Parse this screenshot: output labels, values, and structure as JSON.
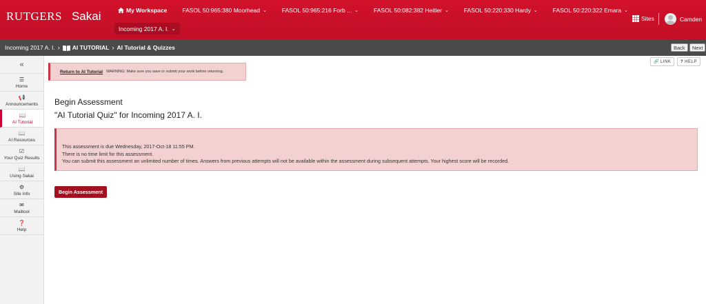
{
  "header": {
    "logo_primary": "RUTGERS",
    "logo_secondary": "Sakai",
    "workspace_label": "My Workspace",
    "site_tabs": [
      {
        "label": "FASOL 50:965:380 Moorhead"
      },
      {
        "label": "FASOL 50:965:216 Forb ..."
      },
      {
        "label": "FASOL 50:082:382 Heitler"
      },
      {
        "label": "FASOL 50:220:330 Hardy"
      },
      {
        "label": "FASOL 50:220:322 Emara"
      }
    ],
    "current_site": "Incoming 2017 A. I.",
    "sites_label": "Sites",
    "user_name": "Camden"
  },
  "breadcrumb": {
    "site": "Incoming 2017 A. I.",
    "tool": "AI TUTORIAL",
    "page": "AI Tutorial & Quizzes",
    "back_label": "Back",
    "next_label": "Next"
  },
  "toolmenu": {
    "collapse_icon": "«",
    "items": [
      {
        "label": "Home",
        "icon": "list-icon",
        "glyph": "☰"
      },
      {
        "label": "Announcements",
        "icon": "megaphone-icon",
        "glyph": "📢"
      },
      {
        "label": "AI Tutorial",
        "icon": "book-icon",
        "glyph": "📖"
      },
      {
        "label": "AI Resources",
        "icon": "book-icon",
        "glyph": "📖"
      },
      {
        "label": "Your Quiz Results",
        "icon": "checkbox-icon",
        "glyph": "☑"
      },
      {
        "label": "Using Sakai",
        "icon": "book-icon",
        "glyph": "📖"
      },
      {
        "label": "Site Info",
        "icon": "gear-icon",
        "glyph": "⚙"
      },
      {
        "label": "Mailtool",
        "icon": "envelope-icon",
        "glyph": "✉"
      },
      {
        "label": "Help",
        "icon": "help-icon",
        "glyph": "❓"
      }
    ]
  },
  "main": {
    "warning_link": "Return to AI Tutorial",
    "warning_text": "WARNING: Make sure you save or submit your work before returning.",
    "link_label": "LINK",
    "help_label": "HELP",
    "title": "Begin Assessment",
    "subtitle": "\"AI Tutorial Quiz\" for Incoming 2017 A. I.",
    "info_lines": [
      "This assessment is due Wednesday, 2017-Oct-18 11:55 PM.",
      "There is no time limit for this assessment.",
      "You can submit this assessment an unlimited number of times. Answers from previous attempts will not be available within the assessment during subsequent attempts. Your highest score will be recorded."
    ],
    "begin_button": "Begin Assessment"
  },
  "colors": {
    "brand_red": "#cc0033",
    "breadcrumb_bg": "#4a4a4a",
    "alert_bg": "#f3d1d1",
    "button_red": "#a3101f"
  }
}
